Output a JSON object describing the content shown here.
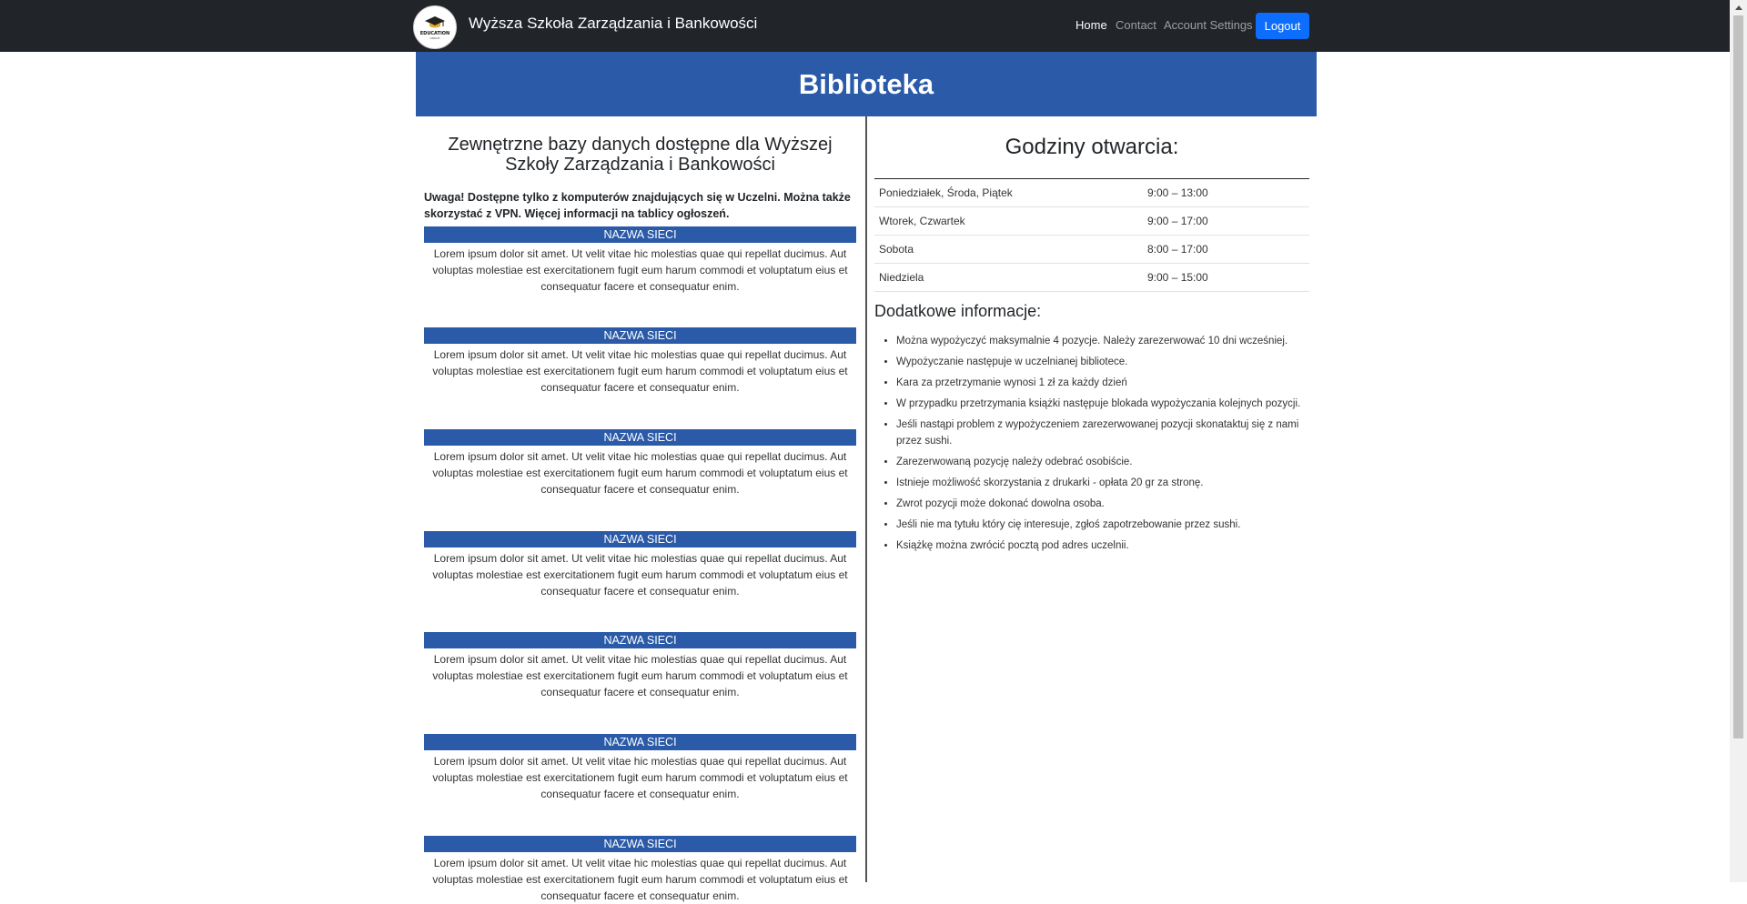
{
  "navbar": {
    "logo_text": "EDUCATION",
    "logo_subtext": "GROUP",
    "brand": "Wyższa Szkoła Zarządzania i Bankowości",
    "links": [
      {
        "label": "Home",
        "active": true
      },
      {
        "label": "Contact",
        "active": false
      },
      {
        "label": "Account Settings",
        "active": false
      }
    ],
    "logout_label": "Logout"
  },
  "hero": {
    "title": "Biblioteka"
  },
  "databases": {
    "title": "Zewnętrzne bazy danych dostępne dla Wyższej Szkoły Zarządzania i Bankowości",
    "warning": "Uwaga! Dostępne tylko z komputerów znajdujących się w Uczelni. Można także skorzystać z VPN. Więcej informacji na tablicy ogłoszeń.",
    "items": [
      {
        "name": "NAZWA SIECI",
        "text": "Lorem ipsum dolor sit amet. Ut velit vitae hic molestias quae qui repellat ducimus. Aut voluptas molestiae est exercitationem fugit eum harum commodi et voluptatum eius et consequatur facere et consequatur enim."
      },
      {
        "name": "NAZWA SIECI",
        "text": "Lorem ipsum dolor sit amet. Ut velit vitae hic molestias quae qui repellat ducimus. Aut voluptas molestiae est exercitationem fugit eum harum commodi et voluptatum eius et consequatur facere et consequatur enim."
      },
      {
        "name": "NAZWA SIECI",
        "text": "Lorem ipsum dolor sit amet. Ut velit vitae hic molestias quae qui repellat ducimus. Aut voluptas molestiae est exercitationem fugit eum harum commodi et voluptatum eius et consequatur facere et consequatur enim."
      },
      {
        "name": "NAZWA SIECI",
        "text": "Lorem ipsum dolor sit amet. Ut velit vitae hic molestias quae qui repellat ducimus. Aut voluptas molestiae est exercitationem fugit eum harum commodi et voluptatum eius et consequatur facere et consequatur enim."
      },
      {
        "name": "NAZWA SIECI",
        "text": "Lorem ipsum dolor sit amet. Ut velit vitae hic molestias quae qui repellat ducimus. Aut voluptas molestiae est exercitationem fugit eum harum commodi et voluptatum eius et consequatur facere et consequatur enim."
      },
      {
        "name": "NAZWA SIECI",
        "text": "Lorem ipsum dolor sit amet. Ut velit vitae hic molestias quae qui repellat ducimus. Aut voluptas molestiae est exercitationem fugit eum harum commodi et voluptatum eius et consequatur facere et consequatur enim."
      },
      {
        "name": "NAZWA SIECI",
        "text": "Lorem ipsum dolor sit amet. Ut velit vitae hic molestias quae qui repellat ducimus. Aut voluptas molestiae est exercitationem fugit eum harum commodi et voluptatum eius et consequatur facere et consequatur enim."
      }
    ]
  },
  "hours": {
    "title": "Godziny otwarcia:",
    "rows": [
      {
        "day": "Poniedziałek, Środa, Piątek",
        "time": "9:00 – 13:00"
      },
      {
        "day": "Wtorek, Czwartek",
        "time": "9:00 – 17:00"
      },
      {
        "day": "Sobota",
        "time": "8:00 – 17:00"
      },
      {
        "day": "Niedziela",
        "time": "9:00 – 15:00"
      }
    ]
  },
  "extra": {
    "title": "Dodatkowe informacje:",
    "items": [
      "Można wypożyczyć maksymalnie 4 pozycje. Należy zarezerwować 10 dni wcześniej.",
      "Wypożyczanie następuje w uczelnianej bibliotece.",
      "Kara za przetrzymanie wynosi 1 zł za każdy dzień",
      "W przypadku przetrzymania książki następuje blokada wypożyczania kolejnych pozycji.",
      "Jeśli nastąpi problem z wypożyczeniem zarezerwowanej pozycji skonataktuj się z nami przez sushi.",
      "Zarezerwowaną pozycję należy odebrać osobiście.",
      "Istnieje możliwość skorzystania z drukarki - opłata 20 gr za stronę.",
      "Zwrot pozycji może dokonać dowolna osoba.",
      "Jeśli nie ma tytułu który cię interesuje, zgłoś zapotrzebowanie przez sushi.",
      "Książkę można zwrócić pocztą pod adres uczelnii."
    ]
  },
  "colors": {
    "navbar": "#212529",
    "accent_blue": "#2b5ba8",
    "button_blue": "#0d6efd"
  }
}
